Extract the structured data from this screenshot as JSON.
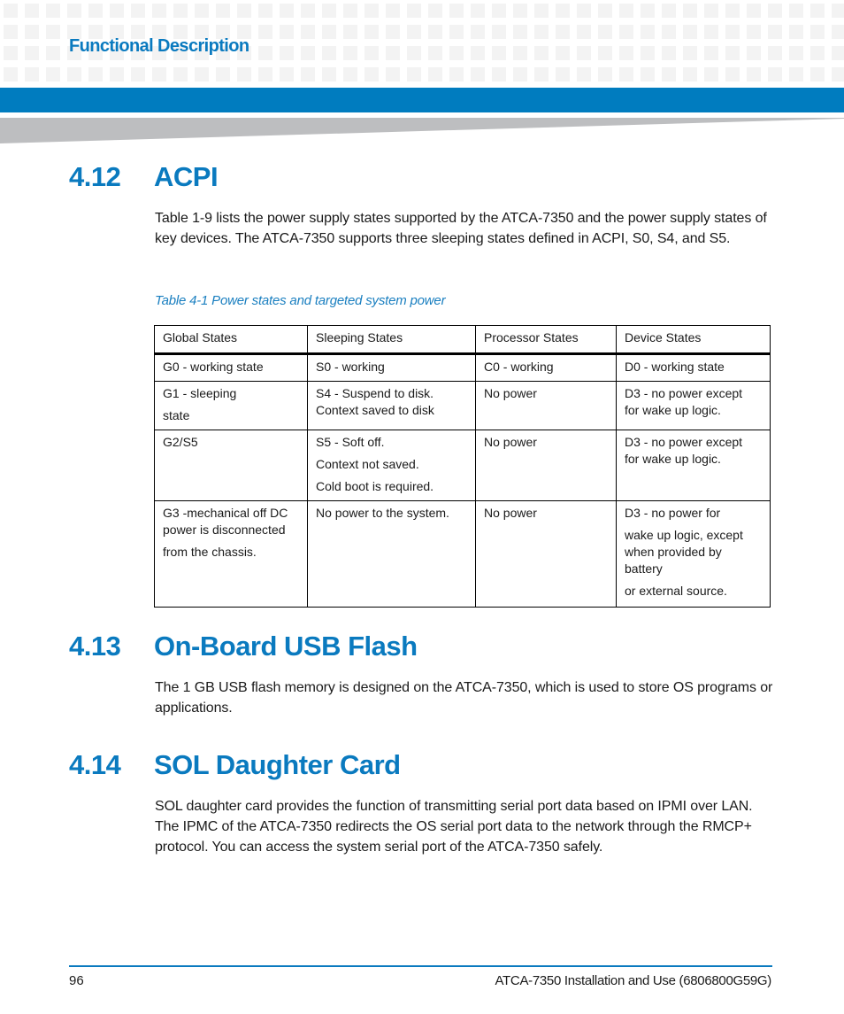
{
  "header": {
    "chapter_title": "Functional Description",
    "accent_color": "#007cbf"
  },
  "sections": [
    {
      "number": "4.12",
      "title": "ACPI",
      "paragraph": "Table 1-9 lists the power supply states supported by the ATCA-7350 and the power supply states of key devices. The ATCA-7350 supports three sleeping states defined in ACPI, S0, S4, and S5."
    },
    {
      "number": "4.13",
      "title": "On-Board USB Flash",
      "paragraph": "The 1 GB USB flash memory is designed on the ATCA-7350, which is used to store OS programs or applications."
    },
    {
      "number": "4.14",
      "title": "SOL Daughter Card",
      "paragraph": "SOL daughter card provides the function of transmitting serial port data based on IPMI over LAN. The IPMC of the ATCA-7350 redirects the OS serial port data to the network through the RMCP+ protocol. You can access the system serial port of the ATCA-7350 safely."
    }
  ],
  "table": {
    "caption": "Table 4-1 Power states and targeted system power",
    "headers": [
      "Global States",
      "Sleeping States",
      "Processor States",
      "Device States"
    ],
    "rows": [
      {
        "global": [
          "G0 - working state"
        ],
        "sleeping": [
          "S0 - working"
        ],
        "processor": [
          "C0 - working"
        ],
        "device": [
          "D0 - working state"
        ]
      },
      {
        "global": [
          "G1 - sleeping",
          "state"
        ],
        "sleeping": [
          "S4 - Suspend to disk.",
          "Context saved to disk"
        ],
        "processor": [
          "No power"
        ],
        "device": [
          "D3 - no power except",
          "for wake up logic."
        ]
      },
      {
        "global": [
          "G2/S5"
        ],
        "sleeping": [
          "S5 - Soft off.",
          "Context not saved.",
          "Cold boot is required."
        ],
        "processor": [
          "No power"
        ],
        "device": [
          "D3 - no power except",
          "for wake up logic."
        ]
      },
      {
        "global": [
          "G3 -mechanical off DC",
          "power is disconnected",
          "from the chassis."
        ],
        "sleeping": [
          "No power to the system."
        ],
        "processor": [
          "No power"
        ],
        "device": [
          "D3 - no power for",
          "wake up logic, except",
          "when provided by",
          "battery",
          "or external source."
        ]
      }
    ]
  },
  "footer": {
    "page_number": "96",
    "document_title": "ATCA-7350 Installation and Use (6806800G59G)"
  }
}
